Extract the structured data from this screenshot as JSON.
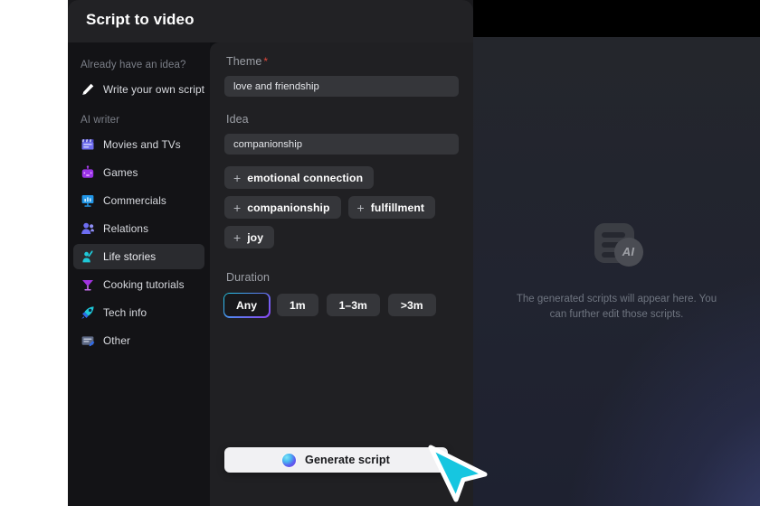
{
  "modal": {
    "title": "Script to video"
  },
  "sidebar": {
    "idea_group_label": "Already have an idea?",
    "write_own": {
      "label": "Write your own script",
      "icon": "pencil-icon"
    },
    "writer_group_label": "AI writer",
    "items": [
      {
        "label": "Movies and TVs",
        "icon": "clapperboard-icon",
        "selected": false
      },
      {
        "label": "Games",
        "icon": "gamepad-icon",
        "selected": false
      },
      {
        "label": "Commercials",
        "icon": "presentation-icon",
        "selected": false
      },
      {
        "label": "Relations",
        "icon": "people-icon",
        "selected": false
      },
      {
        "label": "Life stories",
        "icon": "person-wave-icon",
        "selected": true
      },
      {
        "label": "Cooking tutorials",
        "icon": "cocktail-icon",
        "selected": false
      },
      {
        "label": "Tech info",
        "icon": "rocket-icon",
        "selected": false
      },
      {
        "label": "Other",
        "icon": "note-icon",
        "selected": false
      }
    ]
  },
  "form": {
    "theme": {
      "label": "Theme",
      "required_marker": "*",
      "value": "love and friendship",
      "placeholder": "love and friendship"
    },
    "idea": {
      "label": "Idea",
      "value": "companionship",
      "placeholder": "companionship"
    },
    "suggestions": [
      {
        "plus": "+",
        "label": "emotional connection"
      },
      {
        "plus": "+",
        "label": "companionship"
      },
      {
        "plus": "+",
        "label": "fulfillment"
      },
      {
        "plus": "+",
        "label": "joy"
      }
    ],
    "duration": {
      "label": "Duration",
      "options": [
        {
          "label": "Any",
          "active": true
        },
        {
          "label": "1m",
          "active": false
        },
        {
          "label": "1–3m",
          "active": false
        },
        {
          "label": ">3m",
          "active": false
        }
      ]
    },
    "generate_button": {
      "label": "Generate script",
      "icon": "ai-orb-icon"
    }
  },
  "preview": {
    "icon_badge_text": "AI",
    "empty_text": "The generated scripts will appear here. You can further edit those scripts."
  },
  "colors": {
    "accent_cyan": "#1fd0e8",
    "accent_purple": "#8b46f0",
    "required_red": "#e0483c",
    "modal_bg": "#19191c",
    "panel_bg": "#202023",
    "sidebar_bg": "#131316",
    "cursor": "#16c6e0"
  }
}
